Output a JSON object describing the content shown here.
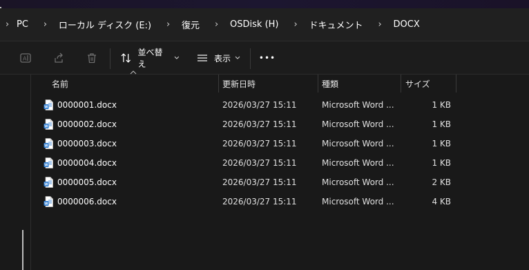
{
  "breadcrumb": {
    "items": [
      "PC",
      "ローカル ディスク (E:)",
      "復元",
      "OSDisk (H)",
      "ドキュメント",
      "DOCX"
    ],
    "separator": "›"
  },
  "toolbar": {
    "sort_label": "並べ替え",
    "view_label": "表示",
    "more_label": "•••"
  },
  "columns": {
    "name": "名前",
    "modified": "更新日時",
    "type": "種類",
    "size": "サイズ"
  },
  "files": [
    {
      "name": "0000001.docx",
      "modified": "2026/03/27 15:11",
      "type": "Microsoft Word ...",
      "size": "1 KB"
    },
    {
      "name": "0000002.docx",
      "modified": "2026/03/27 15:11",
      "type": "Microsoft Word ...",
      "size": "1 KB"
    },
    {
      "name": "0000003.docx",
      "modified": "2026/03/27 15:11",
      "type": "Microsoft Word ...",
      "size": "1 KB"
    },
    {
      "name": "0000004.docx",
      "modified": "2026/03/27 15:11",
      "type": "Microsoft Word ...",
      "size": "1 KB"
    },
    {
      "name": "0000005.docx",
      "modified": "2026/03/27 15:11",
      "type": "Microsoft Word ...",
      "size": "2 KB"
    },
    {
      "name": "0000006.docx",
      "modified": "2026/03/27 15:11",
      "type": "Microsoft Word ...",
      "size": "4 KB"
    }
  ],
  "icons": {
    "rename": "rename-icon",
    "share": "share-icon",
    "delete": "trash-icon",
    "sort": "sort-icon",
    "view": "view-lines-icon",
    "file": "word-document-icon"
  },
  "colors": {
    "background": "#191919",
    "toolbar": "#1c1c1c",
    "breadcrumb_bar": "#202020",
    "word_blue": "#2b7cd3"
  }
}
